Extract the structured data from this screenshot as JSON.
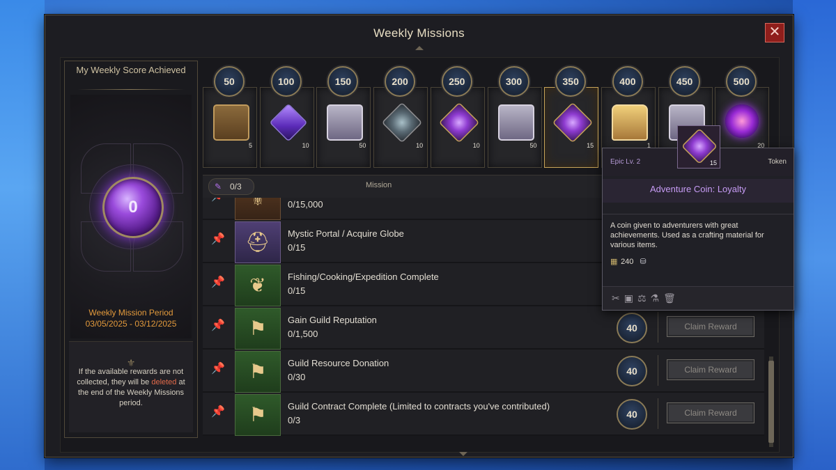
{
  "window": {
    "title": "Weekly Missions",
    "close_label": "✕"
  },
  "left_panel": {
    "title": "My Weekly Score Achieved",
    "score": "0",
    "period_label": "Weekly Mission Period",
    "period_dates": "03/05/2025 - 03/12/2025",
    "note_pre": "If the available rewards are not collected, they will be ",
    "note_red": "deleted",
    "note_post": " at the end of the Weekly Missions period."
  },
  "rewards": [
    {
      "milestone": "50",
      "count": "5",
      "icon": "bronze-chest-icon"
    },
    {
      "milestone": "100",
      "count": "10",
      "icon": "purple-gem-icon"
    },
    {
      "milestone": "150",
      "count": "50",
      "icon": "silver-chest-icon"
    },
    {
      "milestone": "200",
      "count": "10",
      "icon": "grey-medal-icon"
    },
    {
      "milestone": "250",
      "count": "10",
      "icon": "purple-medal-icon"
    },
    {
      "milestone": "300",
      "count": "50",
      "icon": "silver-chest-icon"
    },
    {
      "milestone": "350",
      "count": "15",
      "icon": "adventure-coin-icon",
      "selected": true
    },
    {
      "milestone": "400",
      "count": "1",
      "icon": "golden-treasure-icon"
    },
    {
      "milestone": "450",
      "count": "",
      "icon": "silver-chest-icon"
    },
    {
      "milestone": "500",
      "count": "20",
      "icon": "purple-orb-icon"
    }
  ],
  "mission_header": {
    "pinned_count": "0/3",
    "column_label": "Mission"
  },
  "missions": [
    {
      "name": "",
      "progress": "0/15,000",
      "icon": "brown",
      "glyph": "⚜",
      "points": "",
      "claim": ""
    },
    {
      "name": "Mystic Portal / Acquire Globe",
      "progress": "0/15",
      "icon": "purple",
      "glyph": "⛑",
      "points": "",
      "claim": ""
    },
    {
      "name": "Fishing/Cooking/Expedition Complete",
      "progress": "0/15",
      "icon": "green",
      "glyph": "❦",
      "points": "",
      "claim": ""
    },
    {
      "name": "Gain Guild Reputation",
      "progress": "0/1,500",
      "icon": "green",
      "glyph": "⚑",
      "points": "40",
      "claim": "Claim Reward"
    },
    {
      "name": "Guild Resource Donation",
      "progress": "0/30",
      "icon": "green",
      "glyph": "⚑",
      "points": "40",
      "claim": "Claim Reward"
    },
    {
      "name": "Guild Contract Complete (Limited to contracts you've contributed)",
      "progress": "0/3",
      "icon": "green",
      "glyph": "⚑",
      "points": "40",
      "claim": "Claim Reward"
    }
  ],
  "tooltip": {
    "tier": "Epic Lv. 2",
    "type": "Token",
    "count": "15",
    "name": "Adventure Coin: Loyalty",
    "description": "A coin given to adventurers with great achievements. Used as a crafting material for various items.",
    "value": "240",
    "footer_icons": [
      "dismantle-icon",
      "storage-icon",
      "trade-icon",
      "craft-icon",
      "delete-icon"
    ]
  },
  "colors": {
    "accent_gold": "#c9a65a",
    "purple": "#8e3bd0",
    "orange_text": "#e39a3c",
    "delete_red": "#e26a4a"
  }
}
